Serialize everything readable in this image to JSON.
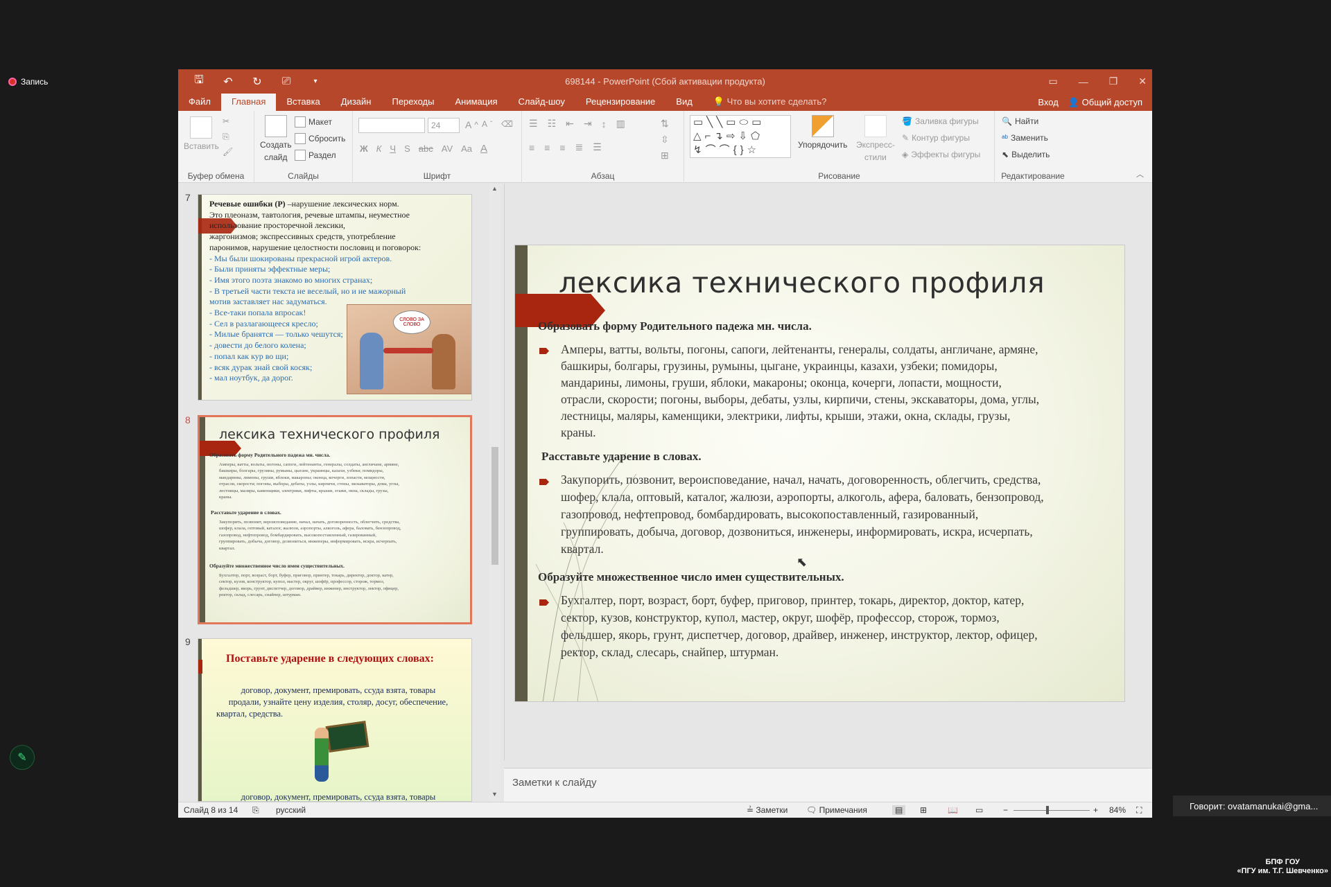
{
  "overlay": {
    "recording": "Запись",
    "speaker": "Говорит:  ovatamanukai@gma...",
    "watermark_line1": "БПФ ГОУ",
    "watermark_line2": "«ПГУ им. Т.Г. Шевченко»"
  },
  "window": {
    "title": "698144 - PowerPoint (Сбой активации продукта)"
  },
  "tabs": [
    "Файл",
    "Главная",
    "Вставка",
    "Дизайн",
    "Переходы",
    "Анимация",
    "Слайд-шоу",
    "Рецензирование",
    "Вид"
  ],
  "tell_me": "Что вы хотите сделать?",
  "signin": "Вход",
  "share": "Общий доступ",
  "ribbon": {
    "clipboard": {
      "paste": "Вставить",
      "label": "Буфер обмена"
    },
    "slides": {
      "new_slide_1": "Создать",
      "new_slide_2": "слайд",
      "layout": "Макет",
      "reset": "Сбросить",
      "section": "Раздел",
      "label": "Слайды"
    },
    "font": {
      "size": "24",
      "label": "Шрифт",
      "bold": "Ж",
      "italic": "К",
      "underline": "Ч",
      "shadow": "S",
      "strike": "abc",
      "spacing": "AV",
      "case": "Aa",
      "color": "A"
    },
    "paragraph": {
      "label": "Абзац"
    },
    "drawing": {
      "arrange": "Упорядочить",
      "quick_styles_1": "Экспресс-",
      "quick_styles_2": "стили",
      "fill": "Заливка фигуры",
      "outline": "Контур фигуры",
      "effects": "Эффекты фигуры",
      "label": "Рисование"
    },
    "editing": {
      "find": "Найти",
      "replace": "Заменить",
      "select": "Выделить",
      "label": "Редактирование"
    }
  },
  "thumbnails": {
    "t7": {
      "num": "7",
      "l1b": "Речевые ошибки (Р)",
      "l1": " –нарушение лексических норм.",
      "l2": "Это плеоназм, тавтология, речевые штампы,  неуместное",
      "l3": "использование просторечной лексики,",
      "l4": "жаргонизмов;  экспрессивных средств,  употребление",
      "l5": "паронимов, нарушение целостности пословиц и поговорок:",
      "b1": "- Мы были шокированы прекрасной игрой актеров.",
      "b2": "- Были приняты эффектные меры;",
      "b3": "- Имя этого поэта знакомо во многих странах;",
      "b4": "- В третьей части текста не веселый, но и не мажорный",
      "b5": "мотив заставляет нас задуматься.",
      "b6": "- Все-таки попала впросак!",
      "b7": "- Сел в разлагающееся кресло;",
      "b8": "- Милые бранятся — только чешутся;",
      "b9": "- довести до белого колена;",
      "b10": "- попал как кур во щи;",
      "b11": "- всяк дурак знай свой косяк;",
      "b12": "- мал ноутбук, да дорог.",
      "bubble": "СЛОВО ЗА СЛОВО"
    },
    "t8": {
      "num": "8"
    },
    "t9": {
      "num": "9",
      "title": "Поставьте ударение в следующих словах:",
      "p1": "договор, документ, премировать, ссуда взята, товары",
      "p2": "продали, узнайте цену изделия, столяр, досуг, обеспечение,",
      "p3": "квартал, средства.",
      "p4": "договор, документ, премировать, ссуда взята, товары"
    }
  },
  "slide": {
    "title": "лексика технического профиля",
    "h1": "Образовать форму Родительного падежа мн. числа.",
    "p1": [
      "Амперы, ватты, вольты, погоны, сапоги, лейтенанты, генералы, солдаты, англичане, армяне,",
      "башкиры, болгары, грузины, румыны, цыгане, украинцы, казахи, узбеки; помидоры,",
      "мандарины, лимоны, груши, яблоки, макароны; оконца, кочерги, лопасти, мощности,",
      "отрасли, скорости; погоны, выборы, дебаты, узлы, кирпичи, стены, экскаваторы, дома, углы,",
      "лестницы, маляры, каменщики, электрики, лифты, крыши, этажи, окна, склады, грузы,",
      "краны."
    ],
    "h2": "Расставьте ударение в словах.",
    "p2": [
      "Закупорить, позвонит, вероисповедание, начал, начать, договоренность, облегчить, средства,",
      "шофер, клала, оптовый, каталог, жалюзи, аэропорты, алкоголь, афера, баловать, бензопровод,",
      "газопровод, нефтепровод, бомбардировать, высокопоставленный, газированный,",
      "группировать, добыча, договор, дозвониться, инженеры, информировать, искра, исчерпать,",
      "квартал."
    ],
    "h3": "Образуйте множественное число имен существительных.",
    "p3": [
      "Бухгалтер, порт, возраст, борт, буфер, приговор, принтер, токарь, директор, доктор, катер,",
      "сектор, кузов, конструктор, купол, мастер, округ, шофёр, профессор, сторож, тормоз,",
      "фельдшер, якорь, грунт, диспетчер, договор, драйвер, инженер, инструктор, лектор, офицер,",
      "ректор, склад, слесарь, снайпер, штурман."
    ]
  },
  "notes_placeholder": "Заметки к слайду",
  "status": {
    "slide": "Слайд 8 из 14",
    "lang": "русский",
    "notes": "Заметки",
    "comments": "Примечания",
    "zoom": "84%"
  }
}
